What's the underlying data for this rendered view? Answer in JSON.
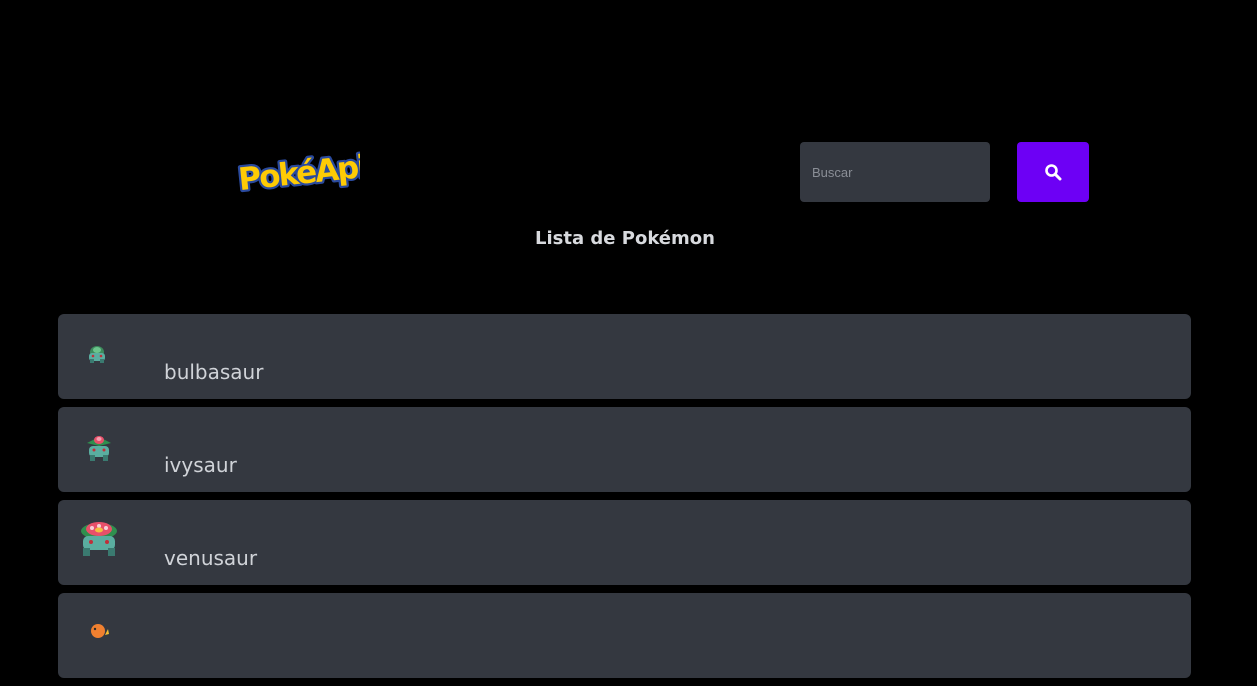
{
  "header": {
    "logo_text": "PokéAPI",
    "logo_alt": "PokéAPI",
    "search": {
      "placeholder": "Buscar",
      "value": ""
    },
    "search_button_icon": "search-icon"
  },
  "main": {
    "title": "Lista de Pokémon",
    "pokemon": [
      {
        "name": "bulbasaur",
        "sprite_icon": "bulbasaur-sprite"
      },
      {
        "name": "ivysaur",
        "sprite_icon": "ivysaur-sprite"
      },
      {
        "name": "venusaur",
        "sprite_icon": "venusaur-sprite"
      },
      {
        "name": "",
        "sprite_icon": "charmander-sprite"
      }
    ]
  },
  "colors": {
    "background": "#000000",
    "card": "#343840",
    "accent": "#6d00f5",
    "logo_yellow": "#ffcb05",
    "logo_blue": "#2a4a9e"
  }
}
